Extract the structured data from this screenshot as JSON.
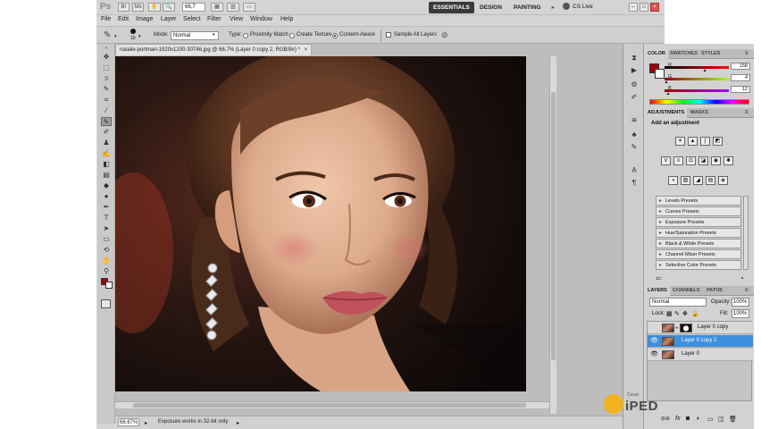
{
  "app": {
    "logo": "Ps",
    "zoom_select": "66,7",
    "workspaces": [
      "ESSENTIALS",
      "DESIGN",
      "PAINTING"
    ],
    "workspace_more": "»",
    "cs_live": "CS Live"
  },
  "menu": [
    "File",
    "Edit",
    "Image",
    "Layer",
    "Select",
    "Filter",
    "View",
    "Window",
    "Help"
  ],
  "options": {
    "brush_size": "19",
    "mode_label": "Mode:",
    "mode_value": "Normal",
    "type_label": "Type:",
    "type_options": [
      "Proximity Match",
      "Create Texture",
      "Content-Aware"
    ],
    "type_selected": "Content-Aware",
    "sample_all_layers": "Sample All Layers"
  },
  "document": {
    "tab_title": "natalie-portman-1920x1200-30746.jpg @ 66,7% (Layer 0 copy 2, RGB/8#) *",
    "tab_close": "×",
    "zoom": "66.67%",
    "status": "Exposure works in 32-bit only"
  },
  "color_panel": {
    "tabs": [
      "COLOR",
      "SWATCHES",
      "STYLES"
    ],
    "channels": [
      {
        "label": "R",
        "value": "158",
        "level": 0.62
      },
      {
        "label": "G",
        "value": "4",
        "level": 0.02
      },
      {
        "label": "B",
        "value": "12",
        "level": 0.05
      }
    ],
    "foreground": "#9e040c",
    "background": "#ffffff"
  },
  "adjustments_panel": {
    "tabs": [
      "ADJUSTMENTS",
      "MASKS"
    ],
    "heading": "Add an adjustment",
    "icons_row1": [
      "brightness-icon",
      "levels-icon",
      "curves-icon",
      "exposure-icon"
    ],
    "icons_row2": [
      "vibrance-icon",
      "hue-saturation-icon",
      "color-balance-icon",
      "black-white-icon",
      "photo-filter-icon",
      "channel-mixer-icon"
    ],
    "icons_row3": [
      "invert-icon",
      "posterize-icon",
      "threshold-icon",
      "gradient-map-icon",
      "selective-color-icon"
    ],
    "presets": [
      "Levels Presets",
      "Curves Presets",
      "Exposure Presets",
      "Hue/Saturation Presets",
      "Black & White Presets",
      "Channel Mixer Presets",
      "Selective Color Presets"
    ]
  },
  "layers_panel": {
    "tabs": [
      "LAYERS",
      "CHANNELS",
      "PATHS"
    ],
    "blend_mode": "Normal",
    "opacity_label": "Opacity:",
    "opacity_value": "100%",
    "lock_label": "Lock:",
    "fill_label": "Fill:",
    "fill_value": "100%",
    "layers": [
      {
        "name": "Layer 0 copy",
        "visible": false,
        "selected": false,
        "has_mask": true
      },
      {
        "name": "Layer 0 copy 2",
        "visible": true,
        "selected": true,
        "has_mask": false
      },
      {
        "name": "Layer 0",
        "visible": true,
        "selected": false,
        "has_mask": false
      }
    ]
  },
  "watermark": {
    "small": "Curso",
    "brand": "iPED"
  }
}
